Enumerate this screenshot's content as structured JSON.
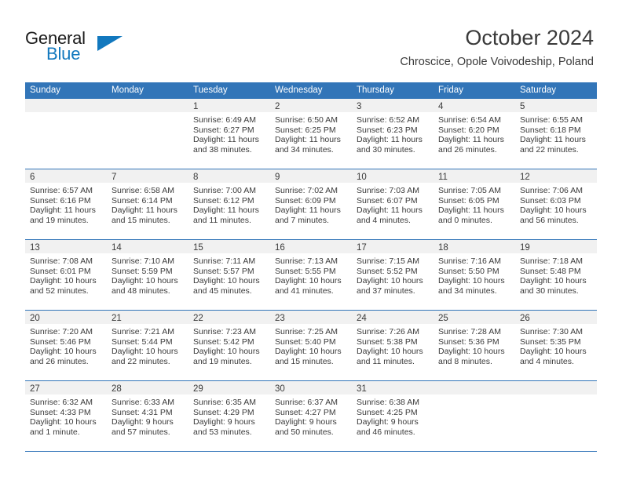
{
  "brand": {
    "name_part1": "General",
    "name_part2": "Blue",
    "triangle_icon": "triangle-right-icon",
    "accent_color": "#1278be"
  },
  "header": {
    "title": "October 2024",
    "subtitle": "Chroscice, Opole Voivodeship, Poland"
  },
  "theme": {
    "header_blue": "#3275b8",
    "day_band_gray": "#f1f1f1",
    "text_color": "#3a3a3a"
  },
  "weekdays": [
    "Sunday",
    "Monday",
    "Tuesday",
    "Wednesday",
    "Thursday",
    "Friday",
    "Saturday"
  ],
  "weeks": [
    [
      {
        "empty": true
      },
      {
        "empty": true
      },
      {
        "day": "1",
        "sunrise": "Sunrise: 6:49 AM",
        "sunset": "Sunset: 6:27 PM",
        "daylight": "Daylight: 11 hours and 38 minutes."
      },
      {
        "day": "2",
        "sunrise": "Sunrise: 6:50 AM",
        "sunset": "Sunset: 6:25 PM",
        "daylight": "Daylight: 11 hours and 34 minutes."
      },
      {
        "day": "3",
        "sunrise": "Sunrise: 6:52 AM",
        "sunset": "Sunset: 6:23 PM",
        "daylight": "Daylight: 11 hours and 30 minutes."
      },
      {
        "day": "4",
        "sunrise": "Sunrise: 6:54 AM",
        "sunset": "Sunset: 6:20 PM",
        "daylight": "Daylight: 11 hours and 26 minutes."
      },
      {
        "day": "5",
        "sunrise": "Sunrise: 6:55 AM",
        "sunset": "Sunset: 6:18 PM",
        "daylight": "Daylight: 11 hours and 22 minutes."
      }
    ],
    [
      {
        "day": "6",
        "sunrise": "Sunrise: 6:57 AM",
        "sunset": "Sunset: 6:16 PM",
        "daylight": "Daylight: 11 hours and 19 minutes."
      },
      {
        "day": "7",
        "sunrise": "Sunrise: 6:58 AM",
        "sunset": "Sunset: 6:14 PM",
        "daylight": "Daylight: 11 hours and 15 minutes."
      },
      {
        "day": "8",
        "sunrise": "Sunrise: 7:00 AM",
        "sunset": "Sunset: 6:12 PM",
        "daylight": "Daylight: 11 hours and 11 minutes."
      },
      {
        "day": "9",
        "sunrise": "Sunrise: 7:02 AM",
        "sunset": "Sunset: 6:09 PM",
        "daylight": "Daylight: 11 hours and 7 minutes."
      },
      {
        "day": "10",
        "sunrise": "Sunrise: 7:03 AM",
        "sunset": "Sunset: 6:07 PM",
        "daylight": "Daylight: 11 hours and 4 minutes."
      },
      {
        "day": "11",
        "sunrise": "Sunrise: 7:05 AM",
        "sunset": "Sunset: 6:05 PM",
        "daylight": "Daylight: 11 hours and 0 minutes."
      },
      {
        "day": "12",
        "sunrise": "Sunrise: 7:06 AM",
        "sunset": "Sunset: 6:03 PM",
        "daylight": "Daylight: 10 hours and 56 minutes."
      }
    ],
    [
      {
        "day": "13",
        "sunrise": "Sunrise: 7:08 AM",
        "sunset": "Sunset: 6:01 PM",
        "daylight": "Daylight: 10 hours and 52 minutes."
      },
      {
        "day": "14",
        "sunrise": "Sunrise: 7:10 AM",
        "sunset": "Sunset: 5:59 PM",
        "daylight": "Daylight: 10 hours and 48 minutes."
      },
      {
        "day": "15",
        "sunrise": "Sunrise: 7:11 AM",
        "sunset": "Sunset: 5:57 PM",
        "daylight": "Daylight: 10 hours and 45 minutes."
      },
      {
        "day": "16",
        "sunrise": "Sunrise: 7:13 AM",
        "sunset": "Sunset: 5:55 PM",
        "daylight": "Daylight: 10 hours and 41 minutes."
      },
      {
        "day": "17",
        "sunrise": "Sunrise: 7:15 AM",
        "sunset": "Sunset: 5:52 PM",
        "daylight": "Daylight: 10 hours and 37 minutes."
      },
      {
        "day": "18",
        "sunrise": "Sunrise: 7:16 AM",
        "sunset": "Sunset: 5:50 PM",
        "daylight": "Daylight: 10 hours and 34 minutes."
      },
      {
        "day": "19",
        "sunrise": "Sunrise: 7:18 AM",
        "sunset": "Sunset: 5:48 PM",
        "daylight": "Daylight: 10 hours and 30 minutes."
      }
    ],
    [
      {
        "day": "20",
        "sunrise": "Sunrise: 7:20 AM",
        "sunset": "Sunset: 5:46 PM",
        "daylight": "Daylight: 10 hours and 26 minutes."
      },
      {
        "day": "21",
        "sunrise": "Sunrise: 7:21 AM",
        "sunset": "Sunset: 5:44 PM",
        "daylight": "Daylight: 10 hours and 22 minutes."
      },
      {
        "day": "22",
        "sunrise": "Sunrise: 7:23 AM",
        "sunset": "Sunset: 5:42 PM",
        "daylight": "Daylight: 10 hours and 19 minutes."
      },
      {
        "day": "23",
        "sunrise": "Sunrise: 7:25 AM",
        "sunset": "Sunset: 5:40 PM",
        "daylight": "Daylight: 10 hours and 15 minutes."
      },
      {
        "day": "24",
        "sunrise": "Sunrise: 7:26 AM",
        "sunset": "Sunset: 5:38 PM",
        "daylight": "Daylight: 10 hours and 11 minutes."
      },
      {
        "day": "25",
        "sunrise": "Sunrise: 7:28 AM",
        "sunset": "Sunset: 5:36 PM",
        "daylight": "Daylight: 10 hours and 8 minutes."
      },
      {
        "day": "26",
        "sunrise": "Sunrise: 7:30 AM",
        "sunset": "Sunset: 5:35 PM",
        "daylight": "Daylight: 10 hours and 4 minutes."
      }
    ],
    [
      {
        "day": "27",
        "sunrise": "Sunrise: 6:32 AM",
        "sunset": "Sunset: 4:33 PM",
        "daylight": "Daylight: 10 hours and 1 minute."
      },
      {
        "day": "28",
        "sunrise": "Sunrise: 6:33 AM",
        "sunset": "Sunset: 4:31 PM",
        "daylight": "Daylight: 9 hours and 57 minutes."
      },
      {
        "day": "29",
        "sunrise": "Sunrise: 6:35 AM",
        "sunset": "Sunset: 4:29 PM",
        "daylight": "Daylight: 9 hours and 53 minutes."
      },
      {
        "day": "30",
        "sunrise": "Sunrise: 6:37 AM",
        "sunset": "Sunset: 4:27 PM",
        "daylight": "Daylight: 9 hours and 50 minutes."
      },
      {
        "day": "31",
        "sunrise": "Sunrise: 6:38 AM",
        "sunset": "Sunset: 4:25 PM",
        "daylight": "Daylight: 9 hours and 46 minutes."
      },
      {
        "empty": true
      },
      {
        "empty": true
      }
    ]
  ]
}
